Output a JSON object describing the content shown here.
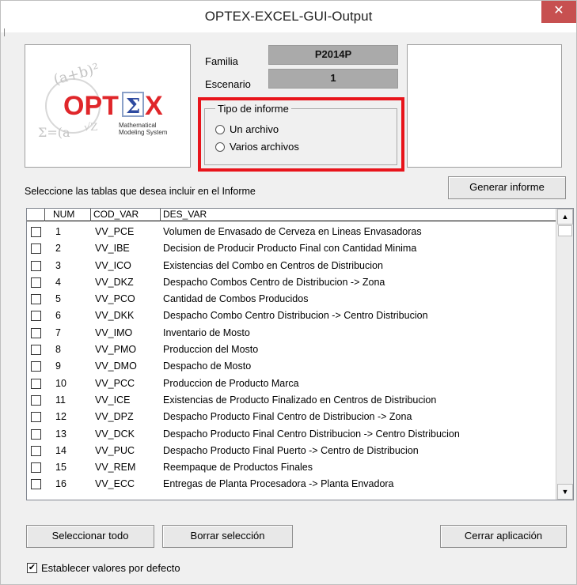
{
  "window": {
    "title": "OPTEX-EXCEL-GUI-Output",
    "close_glyph": "✕"
  },
  "logo": {
    "brand": "OPT",
    "brand_sigma": "Σ",
    "brand_x": "X",
    "tagline_1": "Mathematical",
    "tagline_2": "Modeling System",
    "scribble_top": "(a+b)²",
    "scribble_left": "Σ=(a",
    "scribble_right": "√Z"
  },
  "familia": {
    "label": "Familia",
    "value": "P2014P"
  },
  "escenario": {
    "label": "Escenario",
    "value": "1"
  },
  "tipo_informe": {
    "legend": "Tipo de informe",
    "options": [
      "Un archivo",
      "Varios archivos"
    ]
  },
  "select_prompt": "Seleccione las tablas que desea incluir en el Informe",
  "buttons": {
    "generate": "Generar informe",
    "select_all": "Seleccionar todo",
    "clear_selection": "Borrar selección",
    "close_app": "Cerrar aplicación"
  },
  "table": {
    "columns": [
      "NUM",
      "COD_VAR",
      "DES_VAR"
    ],
    "rows": [
      {
        "num": "1",
        "cod": "VV_PCE",
        "des": "Volumen de Envasado de Cerveza en Lineas Envasadoras"
      },
      {
        "num": "2",
        "cod": "VV_IBE",
        "des": "Decision de Producir Producto Final con Cantidad Minima"
      },
      {
        "num": "3",
        "cod": "VV_ICO",
        "des": "Existencias del Combo en Centros de Distribucion"
      },
      {
        "num": "4",
        "cod": "VV_DKZ",
        "des": "Despacho Combos Centro de Distribucion -> Zona"
      },
      {
        "num": "5",
        "cod": "VV_PCO",
        "des": "Cantidad de Combos Producidos"
      },
      {
        "num": "6",
        "cod": "VV_DKK",
        "des": "Despacho Combo Centro Distribucion -> Centro Distribucion"
      },
      {
        "num": "7",
        "cod": "VV_IMO",
        "des": "Inventario de Mosto"
      },
      {
        "num": "8",
        "cod": "VV_PMO",
        "des": "Produccion del Mosto"
      },
      {
        "num": "9",
        "cod": "VV_DMO",
        "des": "Despacho de Mosto"
      },
      {
        "num": "10",
        "cod": "VV_PCC",
        "des": "Produccion de Producto Marca"
      },
      {
        "num": "11",
        "cod": "VV_ICE",
        "des": "Existencias de Producto Finalizado en Centros de Distribucion"
      },
      {
        "num": "12",
        "cod": "VV_DPZ",
        "des": "Despacho Producto Final Centro de Distribucion -> Zona"
      },
      {
        "num": "13",
        "cod": "VV_DCK",
        "des": "Despacho Producto Final Centro Distribucion -> Centro Distribucion"
      },
      {
        "num": "14",
        "cod": "VV_PUC",
        "des": "Despacho Producto Final Puerto -> Centro de Distribucion"
      },
      {
        "num": "15",
        "cod": "VV_REM",
        "des": "Reempaque de Productos Finales"
      },
      {
        "num": "16",
        "cod": "VV_ECC",
        "des": "Entregas de Planta Procesadora -> Planta Envadora"
      }
    ]
  },
  "defaults_checkbox": {
    "label": "Establecer valores por defecto",
    "checked": true,
    "mark": "✔"
  },
  "scroll": {
    "up": "▲",
    "down": "▼"
  },
  "colors": {
    "highlight": "#e8141b",
    "close": "#c75050",
    "field": "#aaaaaa",
    "brand_red": "#e0262a"
  }
}
